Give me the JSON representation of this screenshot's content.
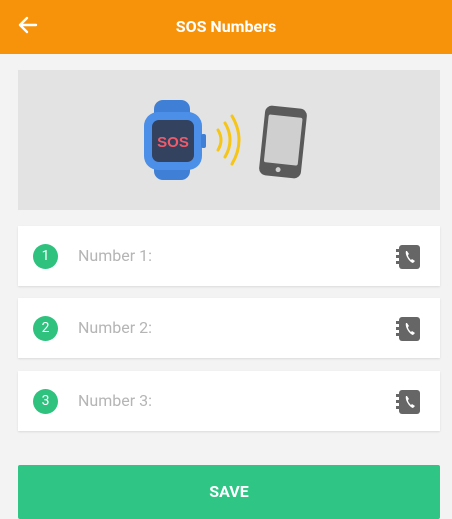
{
  "header": {
    "title": "SOS Numbers",
    "back_icon": "arrow-left-icon"
  },
  "banner": {
    "watch_label": "SOS"
  },
  "numbers": [
    {
      "index": "1",
      "placeholder": "Number 1:"
    },
    {
      "index": "2",
      "placeholder": "Number 2:"
    },
    {
      "index": "3",
      "placeholder": "Number 3:"
    }
  ],
  "save_label": "SAVE",
  "colors": {
    "header": "#f7930b",
    "accent": "#2ec27e",
    "save": "#2ec585"
  }
}
